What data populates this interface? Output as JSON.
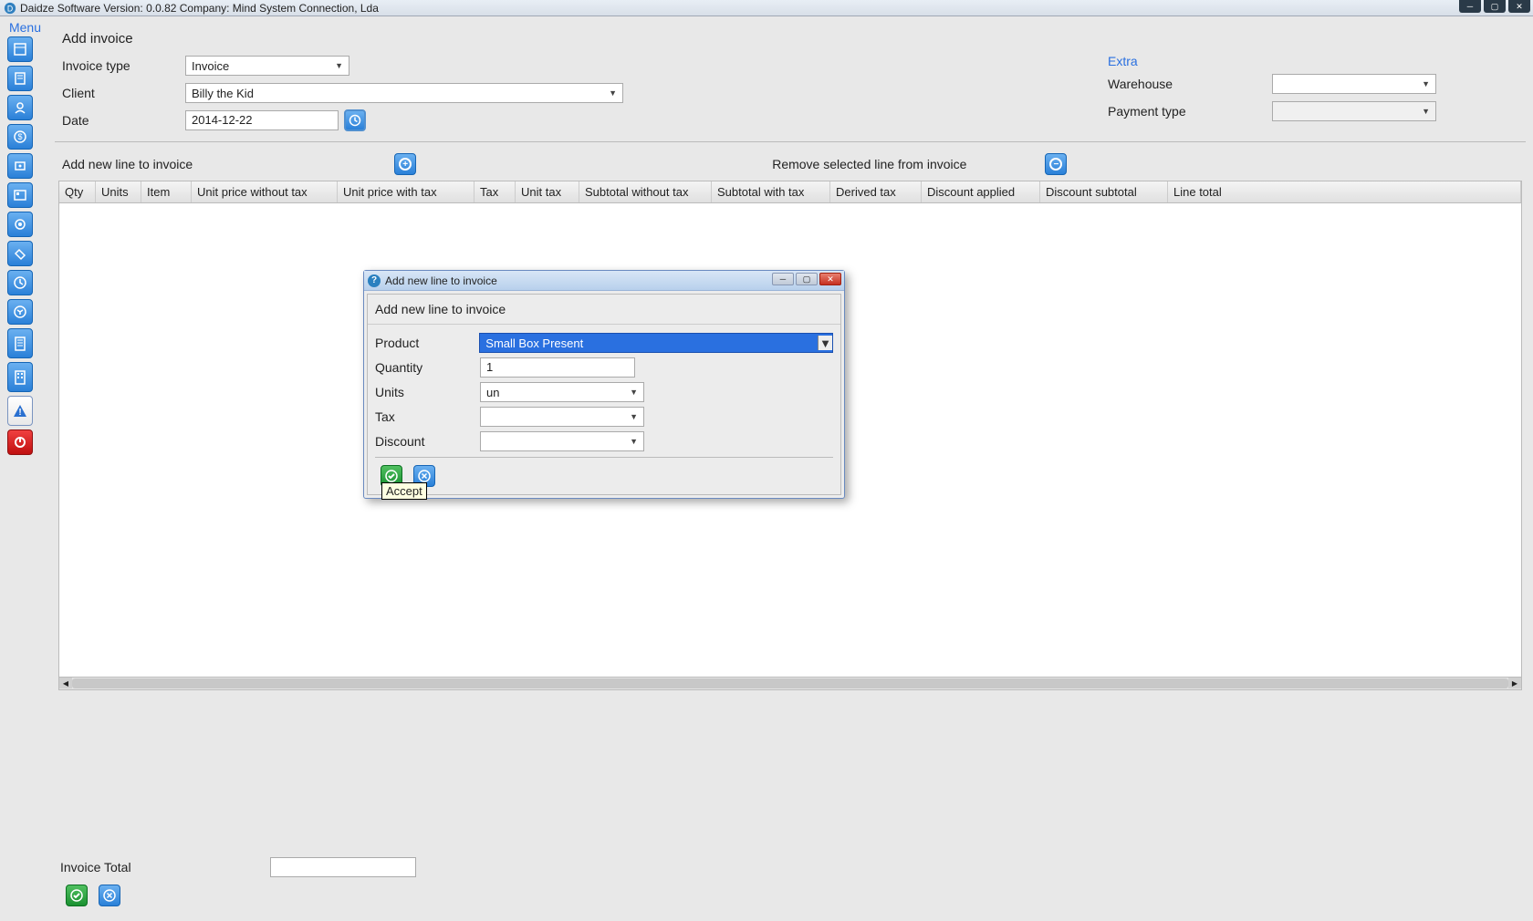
{
  "window": {
    "title": "Daidze Software Version: 0.0.82 Company: Mind System Connection, Lda"
  },
  "menu_label": "Menu",
  "page_title": "Add invoice",
  "form": {
    "invoice_type_label": "Invoice type",
    "invoice_type_value": "Invoice",
    "client_label": "Client",
    "client_value": "Billy the Kid",
    "date_label": "Date",
    "date_value": "2014-12-22"
  },
  "extra": {
    "title": "Extra",
    "warehouse_label": "Warehouse",
    "warehouse_value": "",
    "payment_type_label": "Payment type",
    "payment_type_value": ""
  },
  "lines": {
    "add_label": "Add new line to invoice",
    "remove_label": "Remove selected line from invoice"
  },
  "table": {
    "columns": [
      "Qty",
      "Units",
      "Item",
      "Unit price without tax",
      "Unit price with tax",
      "Tax",
      "Unit tax",
      "Subtotal without tax",
      "Subtotal with tax",
      "Derived tax",
      "Discount applied",
      "Discount subtotal",
      "Line total"
    ]
  },
  "footer": {
    "total_label": "Invoice Total",
    "total_value": ""
  },
  "dialog": {
    "title": "Add new line to invoice",
    "heading": "Add new line to invoice",
    "product_label": "Product",
    "product_value": "Small Box Present",
    "quantity_label": "Quantity",
    "quantity_value": "1",
    "units_label": "Units",
    "units_value": "un",
    "tax_label": "Tax",
    "tax_value": "",
    "discount_label": "Discount",
    "discount_value": ""
  },
  "tooltip": "Accept"
}
